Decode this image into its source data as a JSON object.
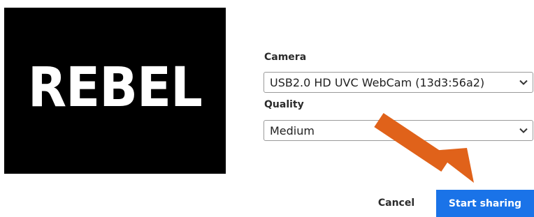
{
  "preview": {
    "logo_text": "REBEL"
  },
  "camera": {
    "label": "Camera",
    "selected": "USB2.0 HD UVC WebCam (13d3:56a2)"
  },
  "quality": {
    "label": "Quality",
    "selected": "Medium"
  },
  "actions": {
    "cancel_label": "Cancel",
    "start_label": "Start sharing"
  },
  "icons": {
    "dropdown": "chevron-down-icon",
    "annotation": "arrow-annotation-icon"
  },
  "colors": {
    "preview_background": "#000000",
    "primary_button": "#1a73e8",
    "annotation_arrow": "#e0621a"
  }
}
